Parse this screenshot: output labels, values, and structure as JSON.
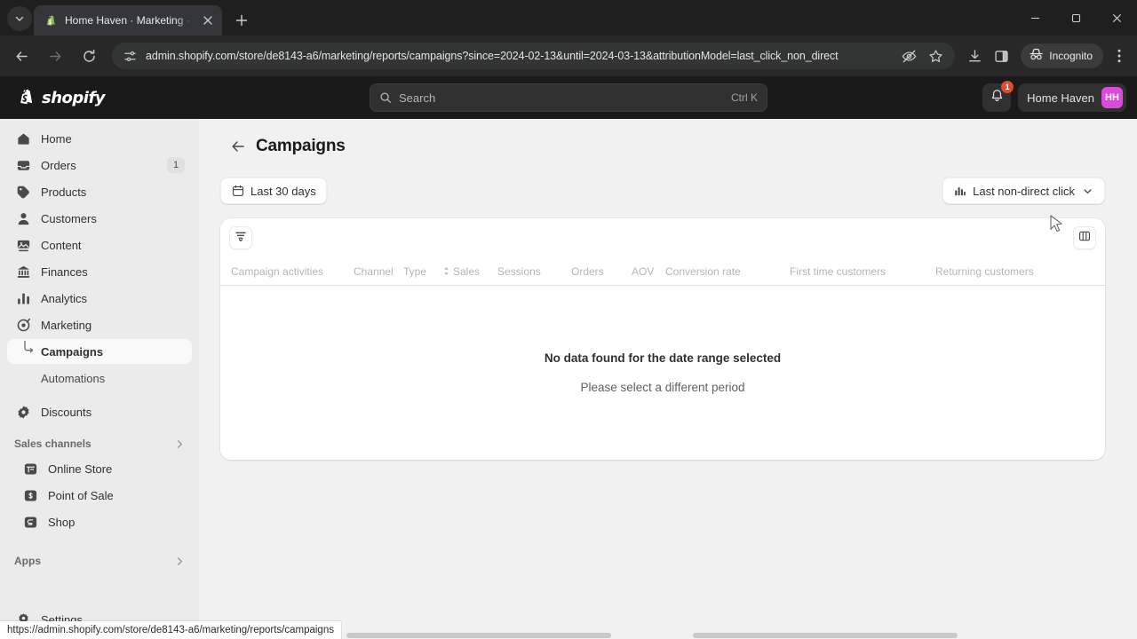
{
  "browser": {
    "tab": {
      "title": "Home Haven · Marketing · Cam",
      "favicon_name": "shopify-favicon",
      "close_label": "×"
    },
    "new_tab_label": "+",
    "url": "admin.shopify.com/store/de8143-a6/marketing/reports/campaigns?since=2024-02-13&until=2024-03-13&attributionModel=last_click_non_direct",
    "incognito_label": "Incognito",
    "status_url": "https://admin.shopify.com/store/de8143-a6/marketing/reports/campaigns"
  },
  "topbar": {
    "brand": "shopify",
    "search": {
      "placeholder": "Search",
      "shortcut": "Ctrl K"
    },
    "notifications_count": "1",
    "store_name": "Home Haven",
    "avatar_initials": "HH"
  },
  "sidebar": {
    "items": [
      {
        "label": "Home",
        "icon": "home-icon"
      },
      {
        "label": "Orders",
        "icon": "orders-icon",
        "badge": "1"
      },
      {
        "label": "Products",
        "icon": "products-icon"
      },
      {
        "label": "Customers",
        "icon": "customers-icon"
      },
      {
        "label": "Content",
        "icon": "content-icon"
      },
      {
        "label": "Finances",
        "icon": "finances-icon"
      },
      {
        "label": "Analytics",
        "icon": "analytics-icon"
      },
      {
        "label": "Marketing",
        "icon": "marketing-icon"
      }
    ],
    "marketing_children": [
      {
        "label": "Campaigns",
        "selected": true
      },
      {
        "label": "Automations",
        "selected": false
      }
    ],
    "discounts": {
      "label": "Discounts",
      "icon": "discounts-icon"
    },
    "sales_channels": {
      "label": "Sales channels",
      "items": [
        {
          "label": "Online Store",
          "icon": "online-store-icon"
        },
        {
          "label": "Point of Sale",
          "icon": "point-of-sale-icon"
        },
        {
          "label": "Shop",
          "icon": "shop-icon"
        }
      ]
    },
    "apps": {
      "label": "Apps"
    },
    "settings": {
      "label": "Settings",
      "icon": "gear-icon"
    }
  },
  "main": {
    "back_label": "←",
    "title": "Campaigns",
    "date_range_label": "Last 30 days",
    "attribution_label": "Last non-direct click",
    "filter_icon": "filter-icon",
    "columns_icon": "columns-icon",
    "columns": [
      {
        "label": "Campaign activities",
        "sortable": false
      },
      {
        "label": "Channel",
        "sortable": false
      },
      {
        "label": "Type",
        "sortable": false
      },
      {
        "label": "Sales",
        "sortable": true
      },
      {
        "label": "Sessions",
        "sortable": false
      },
      {
        "label": "Orders",
        "sortable": false
      },
      {
        "label": "AOV",
        "sortable": false
      },
      {
        "label": "Conversion rate",
        "sortable": false
      },
      {
        "label": "First time customers",
        "sortable": false
      },
      {
        "label": "Returning customers",
        "sortable": false
      }
    ],
    "empty_state": {
      "title": "No data found for the date range selected",
      "subtitle": "Please select a different period"
    }
  },
  "colors": {
    "accent": "#d94bdb",
    "badge": "#e04b2d",
    "app_bg": "#f1f1f1",
    "sidebar_bg": "#ebebeb",
    "topbar_bg": "#1a1a1a"
  }
}
